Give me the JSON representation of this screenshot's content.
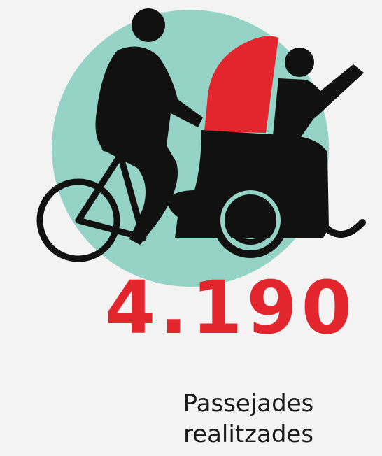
{
  "stat": {
    "value": "4.190",
    "label_line1": "Passejades",
    "label_line2": "realitzades"
  },
  "illustration": {
    "icon": "bike-rickshaw-icon",
    "circle_color": "#94d3c5",
    "accent_color": "#e3262e",
    "figure_color": "#111111"
  }
}
